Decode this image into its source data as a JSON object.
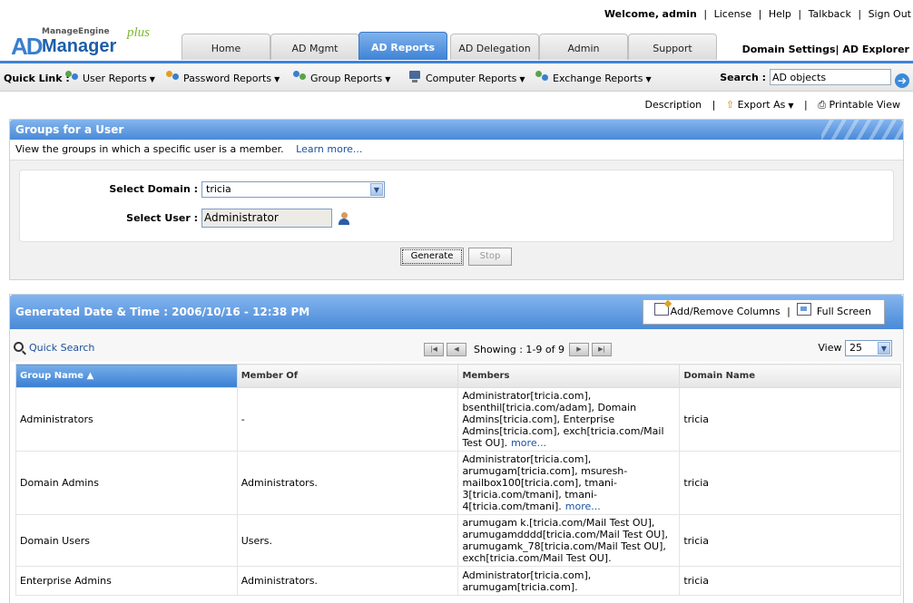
{
  "header": {
    "logo_me": "ManageEngine",
    "logo_ad": "AD",
    "logo_mgr": "Manager",
    "logo_plus": "plus",
    "welcome": "Welcome,",
    "user": "admin",
    "links": [
      "License",
      "Help",
      "Talkback",
      "Sign Out"
    ],
    "tabs": [
      "Home",
      "AD Mgmt",
      "AD Reports",
      "AD Delegation",
      "Admin",
      "Support"
    ],
    "active_tab": "AD Reports",
    "domain_settings": "Domain Settings",
    "ad_explorer": "AD Explorer"
  },
  "quicklinks": {
    "label": "Quick Link :",
    "items": [
      "User Reports",
      "Password Reports",
      "Group Reports",
      "Computer Reports",
      "Exchange Reports"
    ],
    "search_label": "Search :",
    "search_value": "AD objects"
  },
  "actions": {
    "description": "Description",
    "export": "Export As",
    "printable": "Printable View"
  },
  "panel": {
    "title": "Groups for a User",
    "description": "View the groups in which a specific user is a member.",
    "learn_more": "Learn more...",
    "domain_label": "Select Domain :",
    "domain_value": "tricia",
    "user_label": "Select User :",
    "user_value": "Administrator",
    "generate": "Generate",
    "stop": "Stop"
  },
  "results": {
    "title": "Generated Date & Time : 2006/10/16 - 12:38 PM",
    "add_remove": "Add/Remove Columns",
    "full_screen": "Full Screen",
    "quick_search": "Quick Search",
    "showing": "Showing : 1-9 of 9",
    "view_label": "View",
    "view_value": "25",
    "columns": [
      "Group Name ▲",
      "Member Of",
      "Members",
      "Domain Name"
    ],
    "rows": [
      {
        "group": "Administrators",
        "member_of": "-",
        "members": "Administrator[tricia.com], bsenthil[tricia.com/adam], Domain Admins[tricia.com], Enterprise Admins[tricia.com], exch[tricia.com/Mail Test OU].",
        "more": "more...",
        "domain": "tricia"
      },
      {
        "group": "Domain Admins",
        "member_of": "Administrators.",
        "members": "Administrator[tricia.com], arumugam[tricia.com], msuresh-mailbox100[tricia.com], tmani-3[tricia.com/tmani], tmani-4[tricia.com/tmani].",
        "more": "more...",
        "domain": "tricia"
      },
      {
        "group": "Domain Users",
        "member_of": "Users.",
        "members": "arumugam k.[tricia.com/Mail Test OU], arumugamdddd[tricia.com/Mail Test OU], arumugamk_78[tricia.com/Mail Test OU], exch[tricia.com/Mail Test OU].",
        "more": "",
        "domain": "tricia"
      },
      {
        "group": "Enterprise Admins",
        "member_of": "Administrators.",
        "members": "Administrator[tricia.com], arumugam[tricia.com].",
        "more": "",
        "domain": "tricia"
      }
    ]
  },
  "colors": {
    "accent": "#4a8ad8",
    "link": "#1b4f9c"
  }
}
